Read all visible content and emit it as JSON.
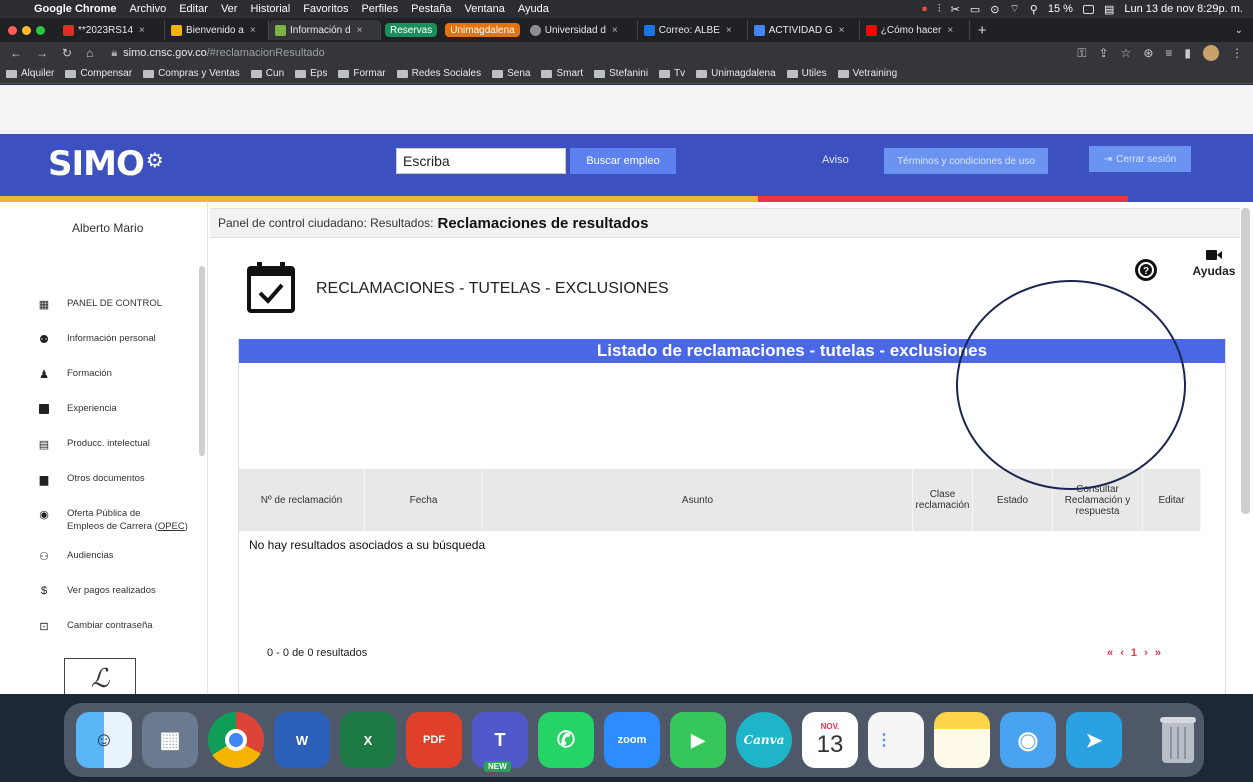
{
  "menubar": {
    "app": "Google Chrome",
    "items": [
      "Archivo",
      "Editar",
      "Ver",
      "Historial",
      "Favoritos",
      "Perfiles",
      "Pestaña",
      "Ventana",
      "Ayuda"
    ],
    "battery": "15 %",
    "datetime": "Lun 13 de nov  8:29p. m."
  },
  "tabs": [
    {
      "title": "**2023RS14",
      "color": "#d93025"
    },
    {
      "title": "Bienvenido a",
      "color": "#f4b400"
    },
    {
      "title": "Información d",
      "color": "#7cb342"
    }
  ],
  "tab_groups": [
    {
      "label": "Reservas",
      "color": "#1a8f5c"
    },
    {
      "label": "Unimagdalena",
      "color": "#e8710a"
    }
  ],
  "tabs_after": [
    {
      "title": "Universidad d",
      "color": "#8e8e8e"
    },
    {
      "title": "Correo: ALBE",
      "color": "#1a73e8"
    },
    {
      "title": "ACTIVIDAD G",
      "color": "#4285f4"
    },
    {
      "title": "¿Cómo hacer",
      "color": "#ff0000"
    }
  ],
  "address": {
    "host": "simo.cnsc.gov.co",
    "path": "/#reclamacionResultado"
  },
  "bookmarks": [
    "Alquiler",
    "Compensar",
    "Compras y Ventas",
    "Cun",
    "Eps",
    "Formar",
    "Redes Sociales",
    "Sena",
    "Smart",
    "Stefanini",
    "Tv",
    "Unimagdalena",
    "Utiles",
    "Vetraining"
  ],
  "header": {
    "logo": "SIMO",
    "search_value": "Escriba",
    "search_button": "Buscar empleo",
    "aviso": "Aviso",
    "terms": "Términos y condiciones de uso",
    "logout": "Cerrar sesión"
  },
  "sidebar": {
    "user": "Alberto Mario",
    "items": [
      {
        "label": "PANEL DE CONTROL",
        "icon": "dashboard-icon"
      },
      {
        "label": "Información personal",
        "icon": "people-icon"
      },
      {
        "label": "Formación",
        "icon": "graduate-icon"
      },
      {
        "label": "Experiencia",
        "icon": "briefcase-icon"
      },
      {
        "label": "Producc. intelectual",
        "icon": "book-icon"
      },
      {
        "label": "Otros documentos",
        "icon": "document-icon"
      },
      {
        "label": "Oferta Pública de",
        "label2_pre": "Empleos de Carrera (",
        "label2_u": "OPEC",
        "label2_post": ")",
        "icon": "globe-icon"
      },
      {
        "label": "Audiencias",
        "icon": "audience-icon"
      },
      {
        "label": "Ver pagos realizados",
        "icon": "dollar-icon"
      },
      {
        "label": "Cambiar contraseña",
        "icon": "lock-icon"
      }
    ]
  },
  "breadcrumb": {
    "prefix": "Panel de control ciudadano: Resultados:",
    "current": "Reclamaciones de resultados"
  },
  "section_title": "RECLAMACIONES - TUTELAS - EXCLUSIONES",
  "help": {
    "ayudas": "Ayudas"
  },
  "panel": {
    "title": "Listado de reclamaciones - tutelas - exclusiones",
    "columns": [
      "Nº de reclamación",
      "Fecha",
      "Asunto",
      "Clase reclamación",
      "Estado",
      "Consultar Reclamación y respuesta",
      "Editar"
    ],
    "empty_message": "No hay resultados asociados a su búsqueda",
    "results_count": "0 - 0 de 0 resultados",
    "pager": {
      "first": "«",
      "prev": "‹",
      "page": "1",
      "next": "›",
      "last": "»"
    }
  },
  "dock": [
    {
      "name": "finder",
      "label": "",
      "color": "#3fa0f5"
    },
    {
      "name": "launchpad",
      "label": "",
      "color": "#6b7a8f"
    },
    {
      "name": "chrome",
      "label": "",
      "color": "#ffffff"
    },
    {
      "name": "word",
      "label": "W",
      "color": "#2b5fb8"
    },
    {
      "name": "excel",
      "label": "X",
      "color": "#1e7a44"
    },
    {
      "name": "pdf",
      "label": "PDF",
      "color": "#e0402a"
    },
    {
      "name": "teams",
      "label": "T",
      "color": "#5059c9",
      "badge": "NEW"
    },
    {
      "name": "whatsapp",
      "label": "✆",
      "color": "#25d366"
    },
    {
      "name": "zoom",
      "label": "zoom",
      "color": "#2d8cff"
    },
    {
      "name": "facetime",
      "label": "▶",
      "color": "#35c759"
    },
    {
      "name": "canva",
      "label": "Canva",
      "color": "#1fb5c8"
    },
    {
      "name": "calendar",
      "label": "13",
      "month": "NOV.",
      "color": "#ffffff"
    },
    {
      "name": "reminders",
      "label": "",
      "color": "#f5f5f5"
    },
    {
      "name": "notes",
      "label": "",
      "color": "#fdd54a"
    },
    {
      "name": "app-blue",
      "label": "◉",
      "color": "#4aa3f0"
    },
    {
      "name": "telegram",
      "label": "➤",
      "color": "#2aa1e0"
    },
    {
      "name": "trash",
      "label": "",
      "color": "#8d95a0"
    }
  ]
}
